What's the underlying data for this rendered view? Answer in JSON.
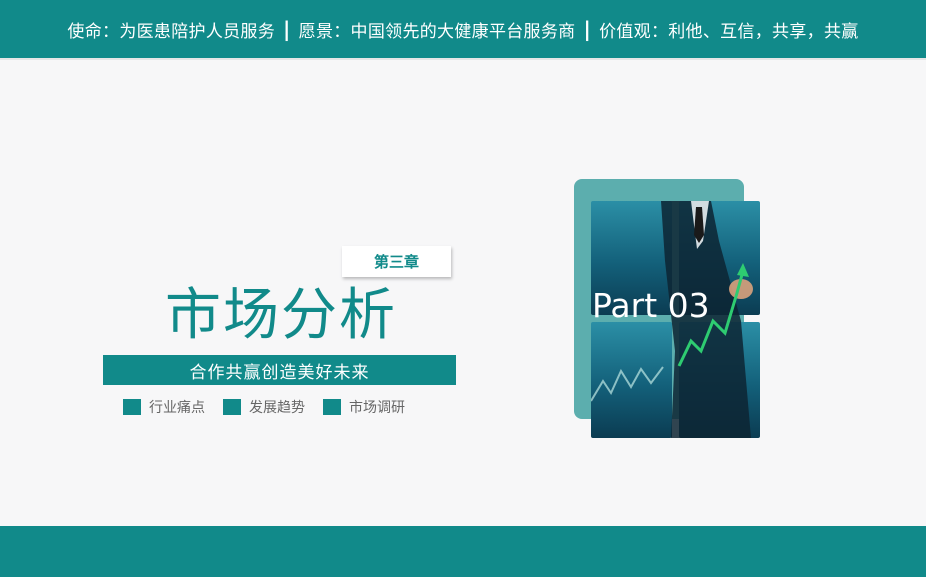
{
  "banner": {
    "mission": "使命：为医患陪护人员服务",
    "vision": "愿景：中国领先的大健康平台服务商",
    "values": "价值观：利他、互信，共享，共赢",
    "separator": "|"
  },
  "slide": {
    "chapter": "第三章",
    "title": "市场分析",
    "subtitle": "合作共赢创造美好未来",
    "tags": [
      "行业痛点",
      "发展趋势",
      "市场调研"
    ],
    "part": "Part 03"
  },
  "colors": {
    "accent": "#118a8a",
    "background": "#f7f7f8",
    "tag_text": "#666666",
    "arrow": "#2ecc71"
  },
  "icons": [
    "tag-square-icon",
    "growth-arrow-icon"
  ]
}
